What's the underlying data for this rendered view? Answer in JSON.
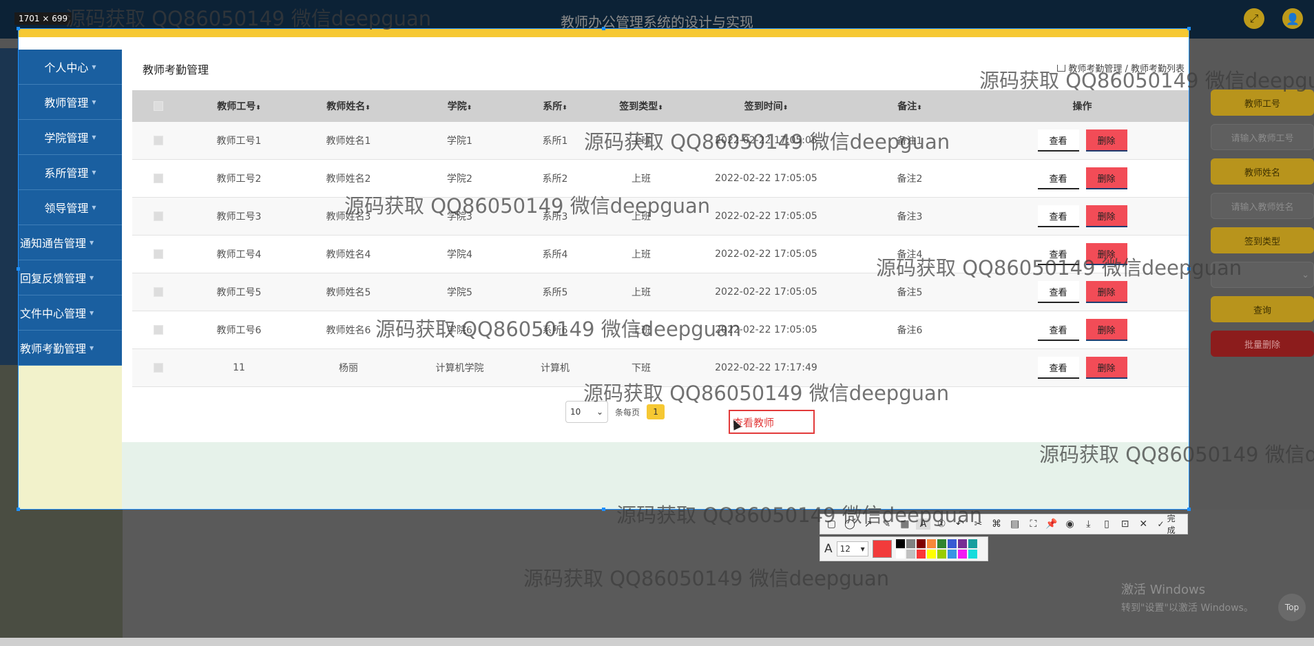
{
  "app_title": "教师办公管理系统的设计与实现",
  "size_label": "1701 × 699",
  "sidebar": {
    "items": [
      {
        "label": "个人中心"
      },
      {
        "label": "教师管理"
      },
      {
        "label": "学院管理"
      },
      {
        "label": "系所管理"
      },
      {
        "label": "领导管理"
      },
      {
        "label": "通知通告管理"
      },
      {
        "label": "回复反馈管理"
      },
      {
        "label": "文件中心管理"
      },
      {
        "label": "教师考勤管理"
      }
    ]
  },
  "page_title": "教师考勤管理",
  "breadcrumb": {
    "level1": "教师考勤管理",
    "sep": " / ",
    "level2": "教师考勤列表"
  },
  "table": {
    "headers": {
      "teacher_id": "教师工号",
      "teacher_name": "教师姓名",
      "college": "学院",
      "department": "系所",
      "checkin_type": "签到类型",
      "checkin_time": "签到时间",
      "note": "备注",
      "action": "操作"
    },
    "sort_glyph": "⬍",
    "rows": [
      {
        "teacher_id": "教师工号1",
        "teacher_name": "教师姓名1",
        "college": "学院1",
        "department": "系所1",
        "checkin_type": "上班",
        "checkin_time": "2022-02-22 17:05:05",
        "note": "备注1"
      },
      {
        "teacher_id": "教师工号2",
        "teacher_name": "教师姓名2",
        "college": "学院2",
        "department": "系所2",
        "checkin_type": "上班",
        "checkin_time": "2022-02-22 17:05:05",
        "note": "备注2"
      },
      {
        "teacher_id": "教师工号3",
        "teacher_name": "教师姓名3",
        "college": "学院3",
        "department": "系所3",
        "checkin_type": "上班",
        "checkin_time": "2022-02-22 17:05:05",
        "note": "备注3"
      },
      {
        "teacher_id": "教师工号4",
        "teacher_name": "教师姓名4",
        "college": "学院4",
        "department": "系所4",
        "checkin_type": "上班",
        "checkin_time": "2022-02-22 17:05:05",
        "note": "备注4"
      },
      {
        "teacher_id": "教师工号5",
        "teacher_name": "教师姓名5",
        "college": "学院5",
        "department": "系所5",
        "checkin_type": "上班",
        "checkin_time": "2022-02-22 17:05:05",
        "note": "备注5"
      },
      {
        "teacher_id": "教师工号6",
        "teacher_name": "教师姓名6",
        "college": "学院6",
        "department": "系所6",
        "checkin_type": "上班",
        "checkin_time": "2022-02-22 17:05:05",
        "note": "备注6"
      },
      {
        "teacher_id": "11",
        "teacher_name": "杨丽",
        "college": "计算机学院",
        "department": "计算机",
        "checkin_type": "下班",
        "checkin_time": "2022-02-22 17:17:49",
        "note": ""
      }
    ],
    "view_label": "查看",
    "delete_label": "删除"
  },
  "pagination": {
    "page_size": "10",
    "per_page_label": "条每页",
    "current_page": "1"
  },
  "annotation_text": "查看教师",
  "right_panel": {
    "teacher_id_label": "教师工号",
    "teacher_id_placeholder": "请输入教师工号",
    "teacher_name_label": "教师姓名",
    "teacher_name_placeholder": "请输入教师姓名",
    "checkin_type_label": "签到类型",
    "query_label": "查询",
    "batch_delete_label": "批量删除"
  },
  "screenshot_toolbar": {
    "done_label": "完成",
    "font_size": "12",
    "current_color": "#f23b3b",
    "palette": [
      "#000000",
      "#808080",
      "#800000",
      "#f7883a",
      "#308430",
      "#385ad3",
      "#772f94",
      "#169e9e",
      "#ffffff",
      "#c0c0c0",
      "#fb3838",
      "#ffff00",
      "#99cc00",
      "#3894e4",
      "#f31bf3",
      "#16dcdc"
    ]
  },
  "windows_activation": {
    "line1": "激活 Windows",
    "line2": "转到\"设置\"以激活 Windows。"
  },
  "top_button_label": "Top",
  "watermark_text": "源码获取 QQ86050149 微信deepguan"
}
